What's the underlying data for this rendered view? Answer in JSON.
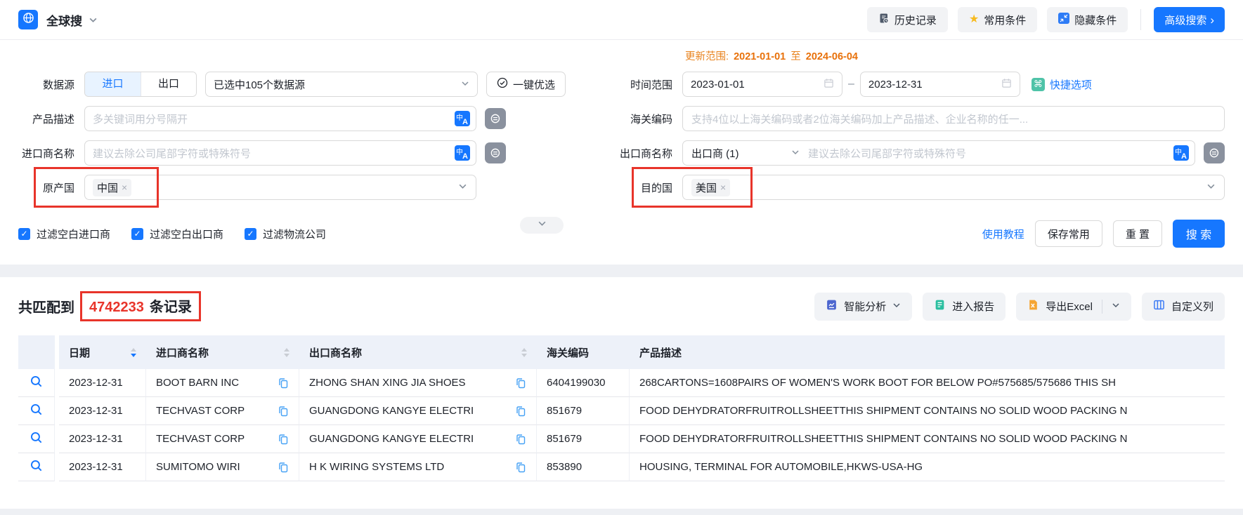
{
  "topbar": {
    "app_title": "全球搜",
    "history_btn": "历史记录",
    "favorite_btn": "常用条件",
    "hide_btn": "隐藏条件",
    "advanced_btn": "高级搜索",
    "advanced_arrow": "›"
  },
  "form": {
    "update_range": {
      "label": "更新范围:",
      "start": "2021-01-01",
      "middle": "至",
      "end": "2024-06-04"
    },
    "data_source": {
      "label": "数据源",
      "tab_import": "进口",
      "tab_export": "出口",
      "selected": "已选中105个数据源",
      "optimize": "一键优选"
    },
    "time_range": {
      "label": "时间范围",
      "start": "2023-01-01",
      "dash": "–",
      "end": "2023-12-31",
      "quick": "快捷选项",
      "quick_icon": "⌘"
    },
    "product": {
      "label": "产品描述",
      "placeholder": "多关键词用分号隔开"
    },
    "hscode": {
      "label": "海关编码",
      "placeholder": "支持4位以上海关编码或者2位海关编码加上产品描述、企业名称的任一..."
    },
    "importer": {
      "label": "进口商名称",
      "placeholder": "建议去除公司尾部字符或特殊符号"
    },
    "exporter": {
      "label": "出口商名称",
      "selector": "出口商 (1)",
      "placeholder": "建议去除公司尾部字符或特殊符号"
    },
    "origin": {
      "label": "原产国",
      "tag": "中国",
      "remove": "×"
    },
    "destination": {
      "label": "目的国",
      "tag": "美国",
      "remove": "×"
    },
    "filters": [
      "过滤空白进口商",
      "过滤空白出口商",
      "过滤物流公司"
    ],
    "check_mark": "✓",
    "translate_zh": "中",
    "translate_en": "A",
    "exclude_icon": "⊜",
    "tutorial_link": "使用教程",
    "save_btn": "保存常用",
    "reset_btn": "重 置",
    "search_btn": "搜 索"
  },
  "results": {
    "prefix": "共匹配到",
    "count": "4742233",
    "suffix": "条记录",
    "analysis_btn": "智能分析",
    "report_btn": "进入报告",
    "export_btn": "导出Excel",
    "columns_btn": "自定义列",
    "table": {
      "headers": [
        "日期",
        "进口商名称",
        "出口商名称",
        "海关编码",
        "产品描述"
      ],
      "rows": [
        {
          "date": "2023-12-31",
          "importer": "BOOT BARN INC",
          "exporter": "ZHONG SHAN XING JIA SHOES",
          "hs": "6404199030",
          "desc": "268CARTONS=1608PAIRS OF WOMEN'S WORK BOOT FOR BELOW PO#575685/575686 THIS SH"
        },
        {
          "date": "2023-12-31",
          "importer": "TECHVAST CORP",
          "exporter": "GUANGDONG KANGYE ELECTRI",
          "hs": "851679",
          "desc": "FOOD DEHYDRATORFRUITROLLSHEETTHIS SHIPMENT CONTAINS NO SOLID WOOD PACKING N"
        },
        {
          "date": "2023-12-31",
          "importer": "TECHVAST CORP",
          "exporter": "GUANGDONG KANGYE ELECTRI",
          "hs": "851679",
          "desc": "FOOD DEHYDRATORFRUITROLLSHEETTHIS SHIPMENT CONTAINS NO SOLID WOOD PACKING N"
        },
        {
          "date": "2023-12-31",
          "importer": "SUMITOMO WIRI",
          "exporter": "H K WIRING SYSTEMS LTD",
          "hs": "853890",
          "desc": "HOUSING, TERMINAL FOR AUTOMOBILE,HKWS-USA-HG"
        }
      ]
    }
  },
  "colors": {
    "primary": "#1677ff",
    "orange_date": "#e8710a",
    "annotation_red": "#e8342a",
    "teal": "#4fc3a8",
    "star_yellow": "#f7ba1e"
  }
}
